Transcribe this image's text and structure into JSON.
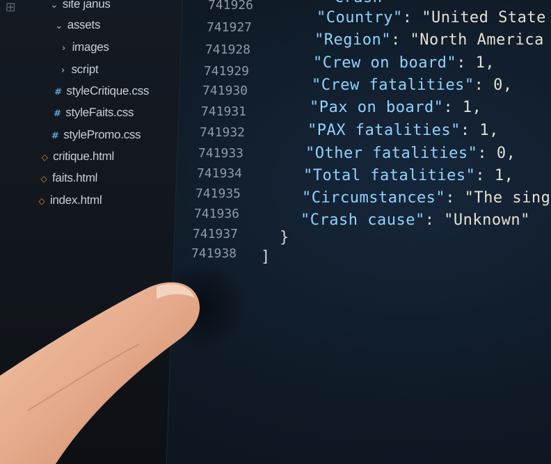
{
  "explorer": {
    "items": [
      {
        "label": "site janus",
        "glyph": "chevron-down",
        "kind": "folder"
      },
      {
        "label": "assets",
        "glyph": "chevron-down",
        "kind": "folder"
      },
      {
        "label": "images",
        "glyph": "chevron-right",
        "kind": "folder"
      },
      {
        "label": "script",
        "glyph": "chevron-right",
        "kind": "folder"
      },
      {
        "label": "styleCritique.css",
        "glyph": "#",
        "kind": "css"
      },
      {
        "label": "styleFaits.css",
        "glyph": "#",
        "kind": "css"
      },
      {
        "label": "stylePromo.css",
        "glyph": "#",
        "kind": "css"
      },
      {
        "label": "critique.html",
        "glyph": "<>",
        "kind": "html"
      },
      {
        "label": "faits.html",
        "glyph": "<>",
        "kind": "html"
      },
      {
        "label": "index.html",
        "glyph": "<>",
        "kind": "html"
      }
    ]
  },
  "editor": {
    "lines": [
      {
        "number": "741926",
        "key": "\"Crash",
        "rest": ""
      },
      {
        "number": "741927",
        "key": "\"Country\"",
        "rest": ": \"United State"
      },
      {
        "number": "741928",
        "key": "\"Region\"",
        "rest": ": \"North America"
      },
      {
        "number": "741929",
        "key": "\"Crew on board\"",
        "rest": ": 1,"
      },
      {
        "number": "741930",
        "key": "\"Crew fatalities\"",
        "rest": ": 0,"
      },
      {
        "number": "741931",
        "key": "\"Pax on board\"",
        "rest": ": 1,"
      },
      {
        "number": "741932",
        "key": "\"PAX fatalities\"",
        "rest": ": 1,"
      },
      {
        "number": "741933",
        "key": "\"Other fatalities\"",
        "rest": ": 0,"
      },
      {
        "number": "741934",
        "key": "\"Total fatalities\"",
        "rest": ": 1,"
      },
      {
        "number": "741935",
        "key": "\"Circumstances\"",
        "rest": ": \"The sing"
      },
      {
        "number": "741936",
        "key": "\"Crash cause\"",
        "rest": ": \"Unknown\""
      },
      {
        "number": "741937",
        "key": "",
        "rest": "}"
      },
      {
        "number": "741938",
        "key": "",
        "rest": "]"
      }
    ]
  },
  "colors": {
    "key": "#8fd3ff",
    "string": "#e4e0d4",
    "line_number": "#8e9aa6",
    "sidebar_bg": "#141a21",
    "editor_bg": "#101c29"
  }
}
